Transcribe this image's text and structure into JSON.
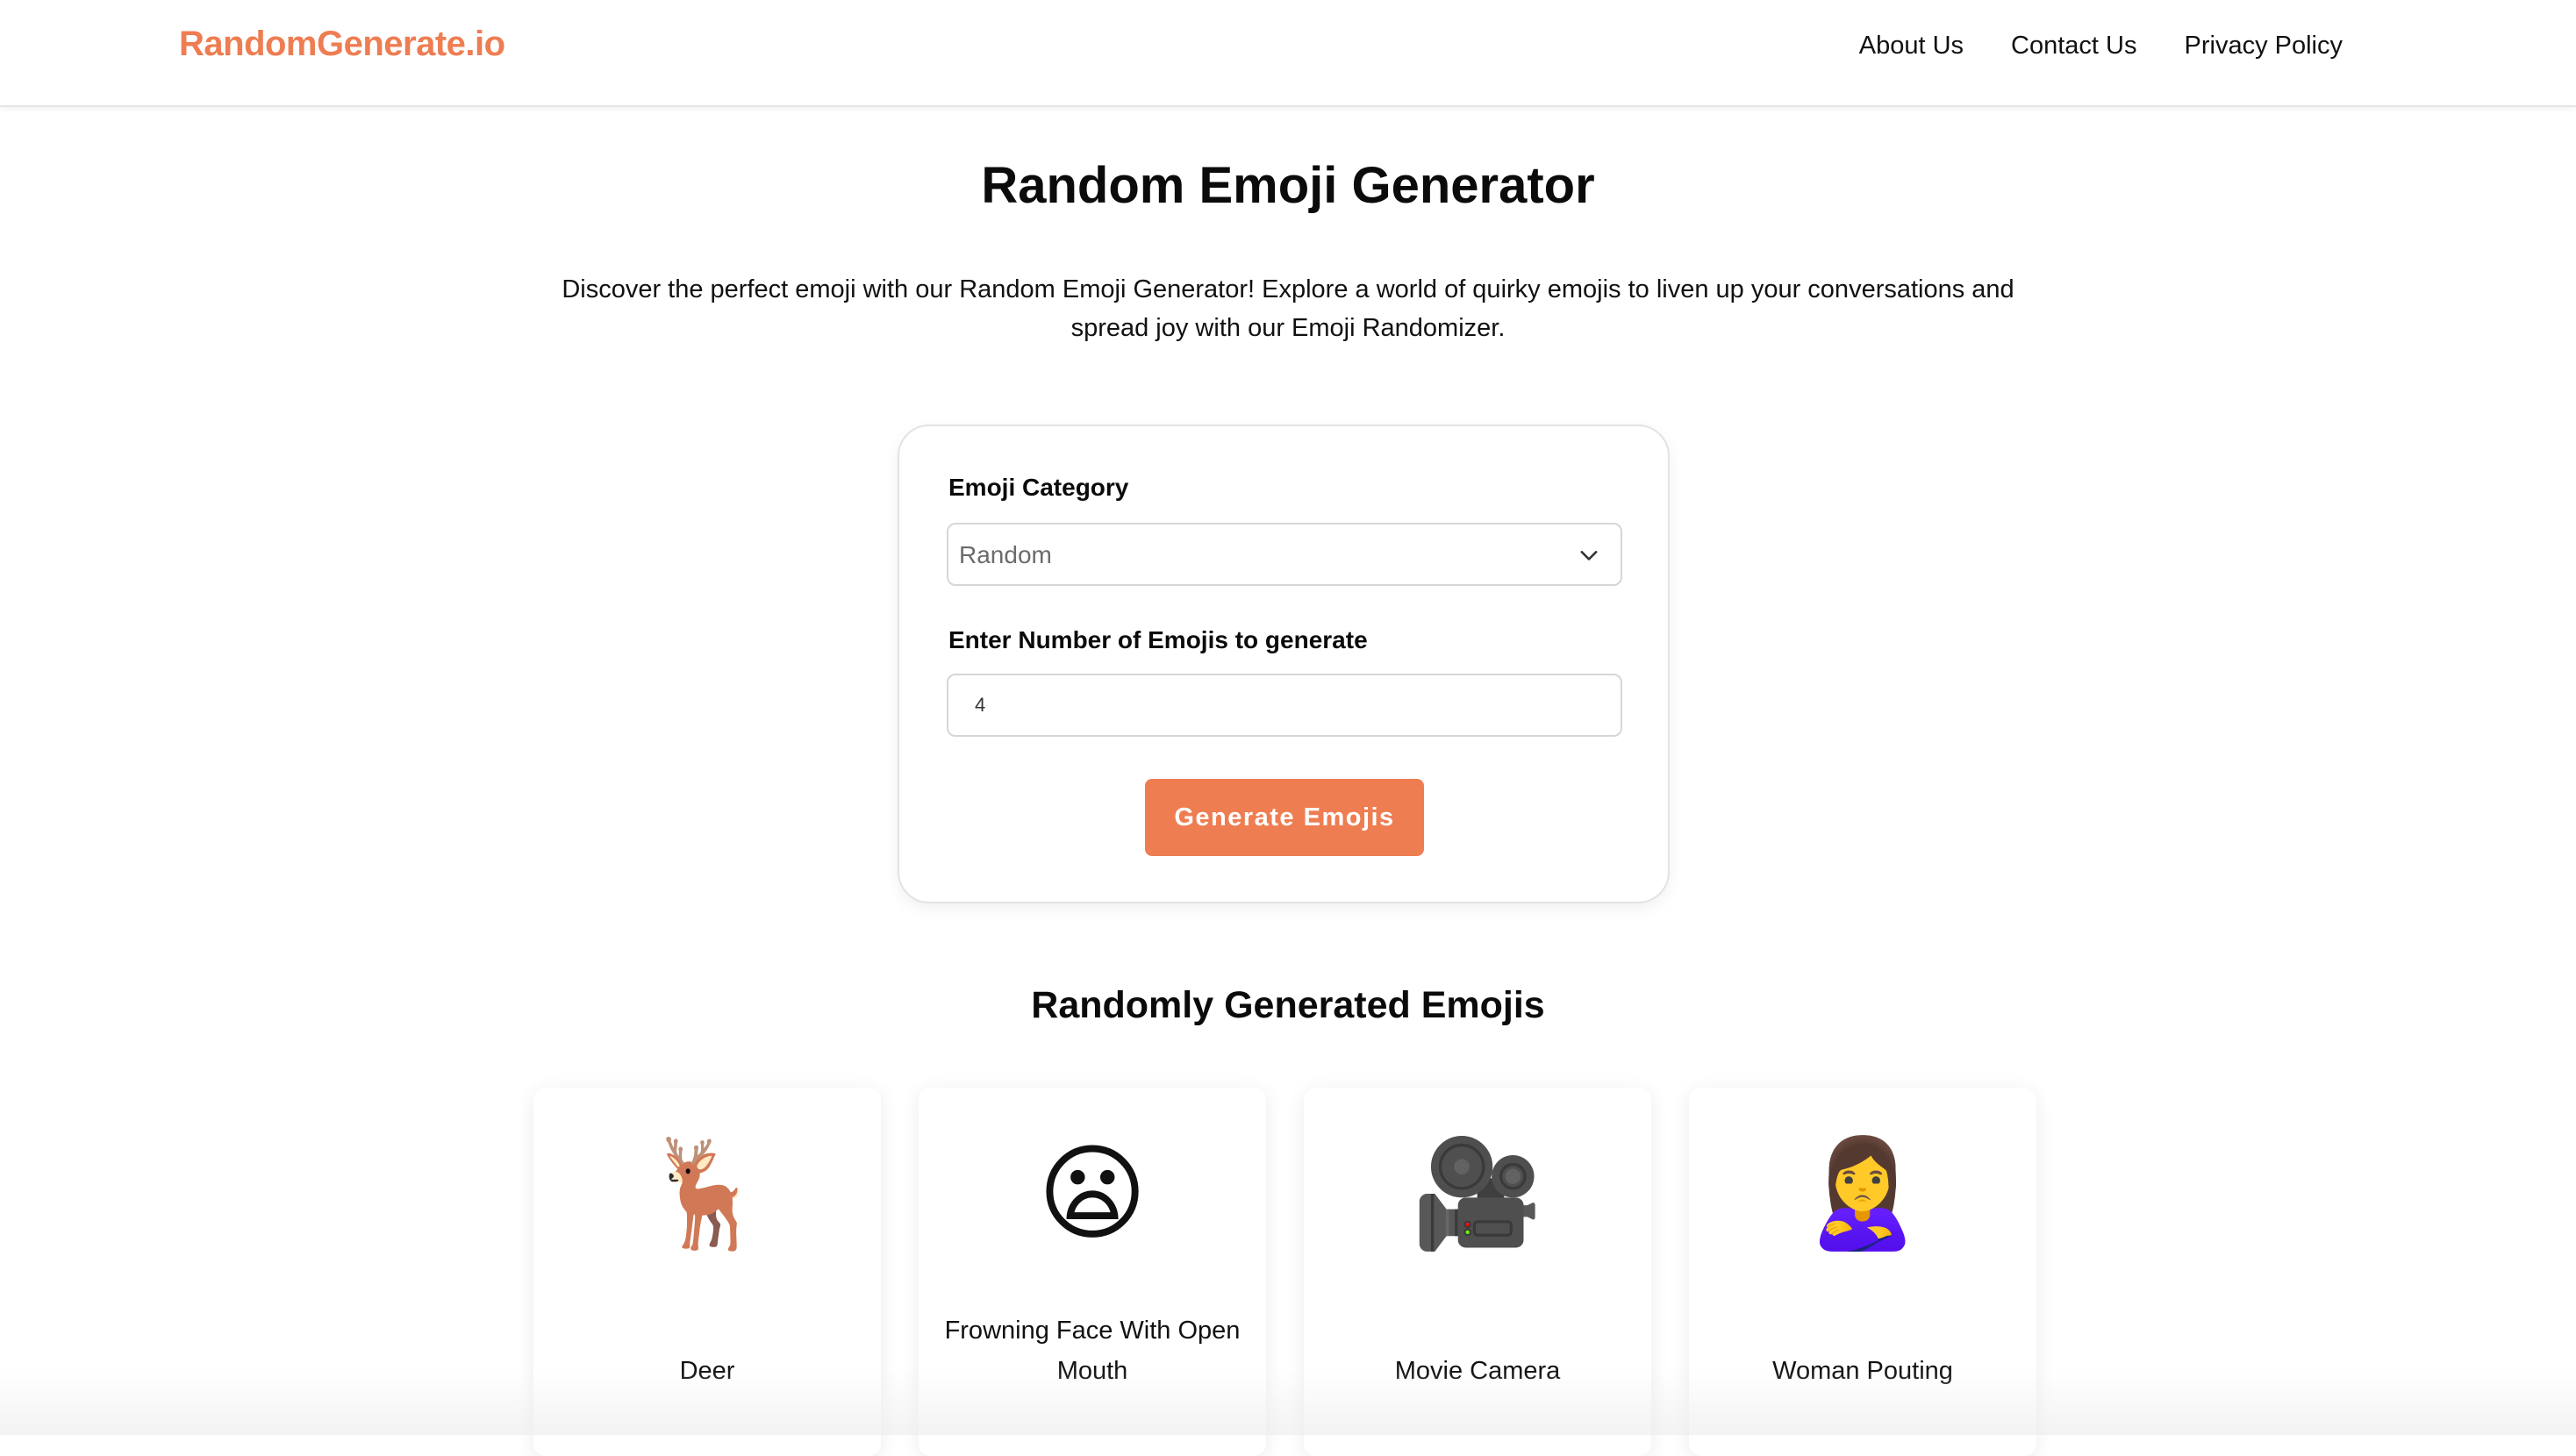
{
  "header": {
    "logo": "RandomGenerate.io",
    "nav": [
      "About Us",
      "Contact Us",
      "Privacy Policy"
    ]
  },
  "main": {
    "title": "Random Emoji Generator",
    "intro": "Discover the perfect emoji with our Random Emoji Generator! Explore a world of quirky emojis to liven up your conversations and spread joy with our Emoji Randomizer."
  },
  "form": {
    "category_label": "Emoji Category",
    "category_value": "Random",
    "count_label": "Enter Number of Emojis to generate",
    "count_value": "4",
    "button_label": "Generate Emojis"
  },
  "results": {
    "title": "Randomly Generated Emojis",
    "items": [
      {
        "emoji": "🦌",
        "name": "Deer"
      },
      {
        "emoji": "😦",
        "name": "Frowning Face With Open Mouth"
      },
      {
        "emoji": "🎥",
        "name": "Movie Camera"
      },
      {
        "emoji": "🙎‍♀️",
        "name": "Woman Pouting"
      }
    ]
  },
  "colors": {
    "accent": "#ee7d52",
    "text": "#111111",
    "border": "#d6d6d6"
  },
  "icons": {
    "select_arrow": "chevron-down-icon"
  }
}
